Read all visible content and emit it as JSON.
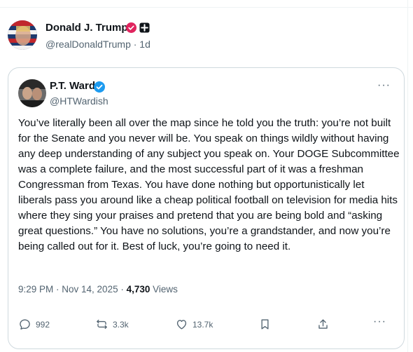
{
  "outer_post": {
    "name": "Donald J. Trump",
    "handle": "@realDonaldTrump · 1d"
  },
  "quoted_post": {
    "name": "P.T. Ward",
    "handle": "@HTWardish",
    "text": "You’ve literally been all over the map since he told you the truth: you’re not built for the Senate and you never will be. You speak on things wildly without having any deep understanding of any subject you speak on. Your DOGE Subcommittee was a complete failure, and the most successful part of it was a freshman Congressman from Texas. You have done nothing but opportunistically let liberals pass you around like a cheap political football on television for media hits where they sing your praises and pretend that you are being bold and “asking great questions.” You have no solutions, you’re a grandstander, and now you’re being called out for it. Best of luck, you’re going to need it.",
    "timestamp": "9:29 PM · Nov 14, 2025 · ",
    "views_count": "4,730",
    "views_label": " Views",
    "more_icon": "···"
  },
  "actions": {
    "replies": "992",
    "reposts": "3.3k",
    "likes": "13.7k"
  },
  "colors": {
    "verified_blue": "#1d9bf0",
    "muted": "#536471",
    "text": "#0f1419",
    "border": "#cfd9de"
  }
}
